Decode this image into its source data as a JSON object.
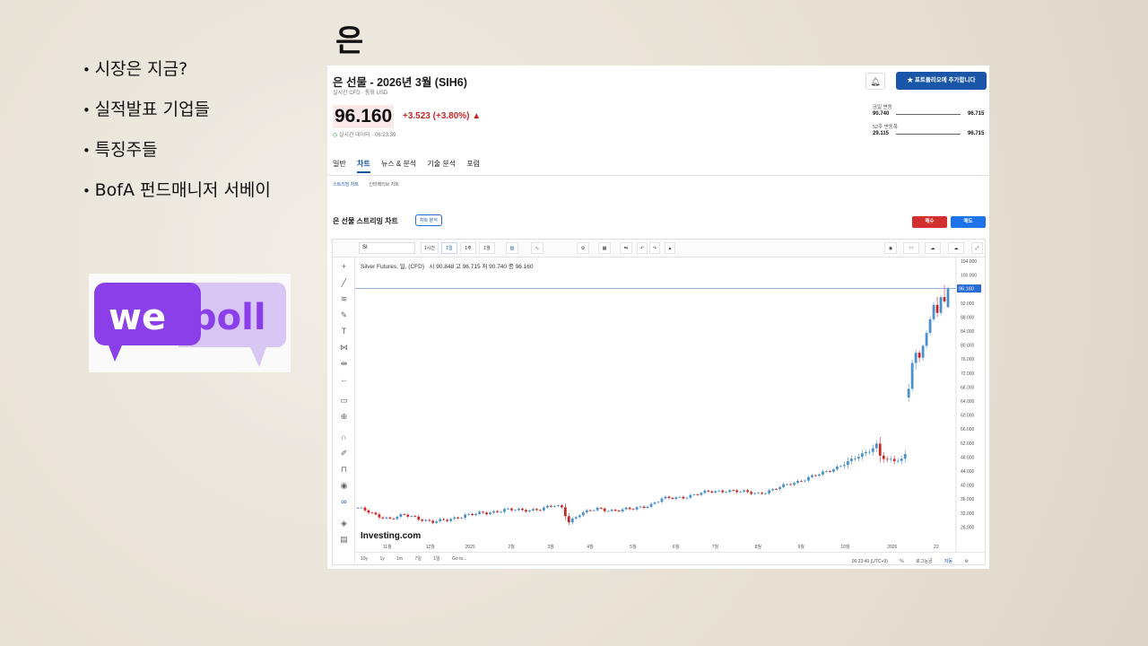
{
  "slide": {
    "title": "은",
    "bullets": [
      "시장은 지금?",
      "실적발표 기업들",
      "특징주들",
      "BofA 펀드매니저 서베이"
    ],
    "logo_text": {
      "we": "we",
      "poll": "poll"
    },
    "colors": {
      "logo_purple": "#8b3fe8",
      "logo_lavender": "#d8c6f5"
    }
  },
  "page": {
    "instrument_title": "은 선물 - 2026년 3월 (SIH6)",
    "meta": "실시간 CFD  ·  통화 USD",
    "price": "96.160",
    "change": "+3.523 (+3.80%) ▲",
    "realtime_label": "실시간 데이터 · 06:23:39",
    "bell_icon": "bell-icon",
    "portfolio_button": "★  포트폴리오에 추가합니다",
    "day_range": {
      "label": "금일 변동",
      "low": "90.740",
      "high": "96.715"
    },
    "week52_range": {
      "label": "52주 변동폭",
      "low": "29.115",
      "high": "96.715"
    },
    "tabs": [
      "일반",
      "차트",
      "뉴스 & 분석",
      "기술 분석",
      "포럼"
    ],
    "active_tab": 1,
    "subtabs": [
      "스트리밍 차트",
      "인터랙티브 차트"
    ],
    "stream_title": "은 선물 스트리밍 차트",
    "chart_analysis_button": "차트 분석",
    "buy_label": "매수",
    "sell_label": "매도",
    "colors": {
      "up": "#4a90c9",
      "down": "#c62828",
      "primary": "#1a56a8"
    }
  },
  "tv": {
    "symbol": "SI",
    "interval_buttons": [
      "1시간",
      "1일",
      "1주",
      "1월"
    ],
    "active_interval": 1,
    "legend": "Silver Futures, 일, (CFD)",
    "ohlc": "시 90.848  고 96.715  저 90.740  종 96.160",
    "watermark": "Investing.com",
    "footer_left": [
      "10y",
      "1y",
      "1m",
      "7일",
      "1일",
      "Go to..."
    ],
    "footer_right": [
      "06:23:49 (UTC+9)",
      "%",
      "로그눈금",
      "자동"
    ]
  },
  "chart_data": {
    "type": "candlestick",
    "title": "Silver Futures, 일, (CFD)",
    "ylim": [
      24,
      104
    ],
    "yticks": [
      104,
      100,
      96,
      92,
      88,
      84,
      80,
      76,
      72,
      68,
      64,
      60,
      56,
      52,
      48,
      44,
      40,
      36,
      32,
      28
    ],
    "ytick_labels": [
      "104.000",
      "100.000",
      "",
      "92.000",
      "88.000",
      "84.000",
      "80.000",
      "76.000",
      "72.000",
      "68.000",
      "64.000",
      "60.000",
      "56.000",
      "52.000",
      "48.000",
      "44.000",
      "40.000",
      "36.000",
      "32.000",
      "28.000"
    ],
    "current_price": 96.16,
    "current_price_label": "96.160",
    "xtick_labels": [
      "11월",
      "12월",
      "2025",
      "2월",
      "3월",
      "4월",
      "5월",
      "6월",
      "7월",
      "8월",
      "9월",
      "10월",
      "2026",
      "22"
    ],
    "anchors": [
      {
        "t": 0,
        "p": 33.5
      },
      {
        "t": 5,
        "p": 31.3
      },
      {
        "t": 9,
        "p": 30.5
      },
      {
        "t": 13,
        "p": 31.3
      },
      {
        "t": 17,
        "p": 30.5
      },
      {
        "t": 21,
        "p": 29.5
      },
      {
        "t": 25,
        "p": 29.9
      },
      {
        "t": 30,
        "p": 31.5
      },
      {
        "t": 36,
        "p": 31.9
      },
      {
        "t": 41,
        "p": 33.1
      },
      {
        "t": 46,
        "p": 32.6
      },
      {
        "t": 51,
        "p": 33.3
      },
      {
        "t": 55,
        "p": 34.0
      },
      {
        "t": 57,
        "p": 33.4
      },
      {
        "t": 59,
        "p": 29.6
      },
      {
        "t": 62,
        "p": 31.8
      },
      {
        "t": 67,
        "p": 33.1
      },
      {
        "t": 72,
        "p": 32.8
      },
      {
        "t": 77,
        "p": 33.1
      },
      {
        "t": 82,
        "p": 34.5
      },
      {
        "t": 85,
        "p": 36.0
      },
      {
        "t": 89,
        "p": 36.3
      },
      {
        "t": 94,
        "p": 37.2
      },
      {
        "t": 98,
        "p": 38.0
      },
      {
        "t": 103,
        "p": 38.5
      },
      {
        "t": 107,
        "p": 38.0
      },
      {
        "t": 112,
        "p": 37.7
      },
      {
        "t": 116,
        "p": 38.5
      },
      {
        "t": 121,
        "p": 40.5
      },
      {
        "t": 125,
        "p": 41.7
      },
      {
        "t": 129,
        "p": 43.0
      },
      {
        "t": 134,
        "p": 45.2
      },
      {
        "t": 138,
        "p": 47.0
      },
      {
        "t": 141,
        "p": 48.7
      },
      {
        "t": 143,
        "p": 50.0
      },
      {
        "t": 145,
        "p": 51.7
      },
      {
        "t": 146,
        "p": 48.5
      },
      {
        "t": 148,
        "p": 47.0
      },
      {
        "t": 150,
        "p": 46.8
      },
      {
        "t": 152,
        "p": 47.3
      },
      {
        "t": 153,
        "p": 48.8
      }
    ],
    "late_candles": [
      [
        154,
        65.0,
        69.0,
        63.8,
        67.5
      ],
      [
        155,
        67.5,
        75.8,
        66.8,
        74.9
      ],
      [
        156,
        74.9,
        78.7,
        73.0,
        77.8
      ],
      [
        157,
        77.8,
        78.5,
        75.2,
        76.4
      ],
      [
        158,
        76.4,
        80.2,
        75.5,
        79.8
      ],
      [
        159,
        79.8,
        84.2,
        79.0,
        83.5
      ],
      [
        160,
        83.5,
        88.2,
        82.8,
        87.4
      ],
      [
        161,
        87.4,
        92.3,
        86.8,
        91.5
      ],
      [
        162,
        91.5,
        93.8,
        88.0,
        89.2
      ],
      [
        163,
        89.2,
        94.3,
        88.5,
        93.7
      ],
      [
        164,
        93.7,
        97.1,
        92.0,
        92.5
      ],
      [
        165,
        90.85,
        96.72,
        90.74,
        96.16
      ]
    ]
  }
}
